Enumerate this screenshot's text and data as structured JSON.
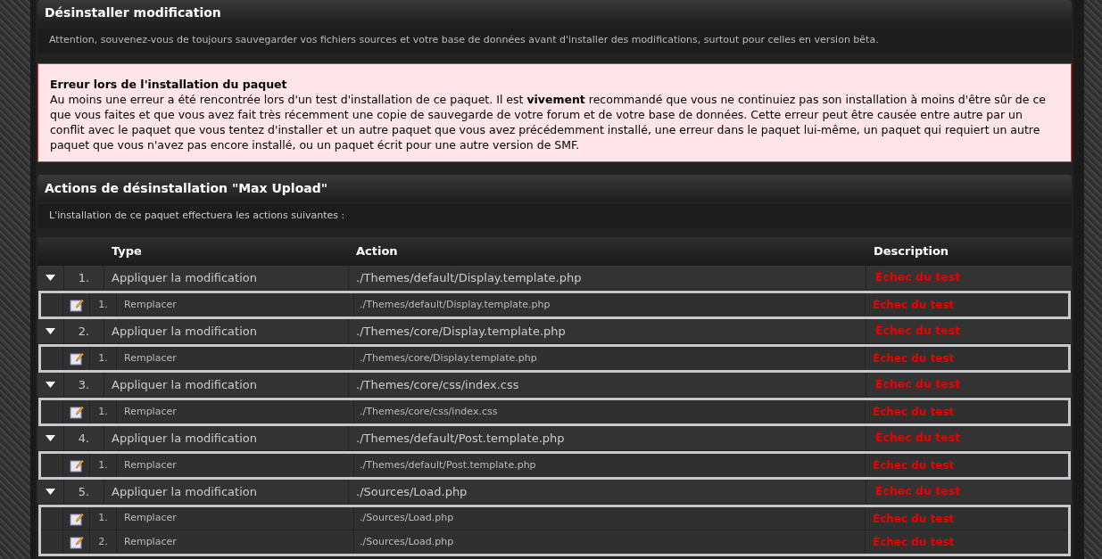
{
  "page_title": "Désinstaller modification",
  "notice": "Attention, souvenez-vous de toujours sauvegarder vos fichiers sources et votre base de données avant d'installer des modifications, surtout pour celles en version bêta.",
  "error": {
    "title": "Erreur lors de l'installation du paquet",
    "text": "Au moins une erreur a été rencontrée lors d'un test d'installation de ce paquet. Il est **vivement** recommandé que vous ne continuiez pas son installation à moins d'être sûr de ce que vous faites et que vous avez fait très récemment une copie de sauvegarde de votre forum et de votre base de données. Cette erreur peut être causée entre autre par un conflit avec le paquet que vous tentez d'installer et un autre paquet que vous avez précédemment installé, une erreur dans le paquet lui-même, un paquet qui requiert un autre paquet que vous n'avez pas encore installé, ou un paquet écrit pour une autre version de SMF."
  },
  "section_title": "Actions de désinstallation \"Max Upload\"",
  "section_info": "L'installation de ce paquet effectuera les actions suivantes :",
  "table": {
    "columns": [
      "Type",
      "Action",
      "Description"
    ],
    "groups": [
      {
        "number": "1.",
        "type": "Appliquer la modification",
        "action": "./Themes/default/Display.template.php",
        "description": "Échec du test",
        "expanded": true,
        "children": [
          {
            "number": "1.",
            "type": "Remplacer",
            "action": "./Themes/default/Display.template.php",
            "description": "Échec du test"
          }
        ]
      },
      {
        "number": "2.",
        "type": "Appliquer la modification",
        "action": "./Themes/core/Display.template.php",
        "description": "Échec du test",
        "expanded": true,
        "children": [
          {
            "number": "1.",
            "type": "Remplacer",
            "action": "./Themes/core/Display.template.php",
            "description": "Échec du test"
          }
        ]
      },
      {
        "number": "3.",
        "type": "Appliquer la modification",
        "action": "./Themes/core/css/index.css",
        "description": "Échec du test",
        "expanded": true,
        "children": [
          {
            "number": "1.",
            "type": "Remplacer",
            "action": "./Themes/core/css/index.css",
            "description": "Échec du test"
          }
        ]
      },
      {
        "number": "4.",
        "type": "Appliquer la modification",
        "action": "./Themes/default/Post.template.php",
        "description": "Échec du test",
        "expanded": true,
        "children": [
          {
            "number": "1.",
            "type": "Remplacer",
            "action": "./Themes/default/Post.template.php",
            "description": "Échec du test"
          }
        ]
      },
      {
        "number": "5.",
        "type": "Appliquer la modification",
        "action": "./Sources/Load.php",
        "description": "Échec du test",
        "expanded": true,
        "children": [
          {
            "number": "1.",
            "type": "Remplacer",
            "action": "./Sources/Load.php",
            "description": "Échec du test"
          },
          {
            "number": "2.",
            "type": "Remplacer",
            "action": "./Sources/Load.php",
            "description": "Échec du test"
          }
        ]
      }
    ]
  }
}
